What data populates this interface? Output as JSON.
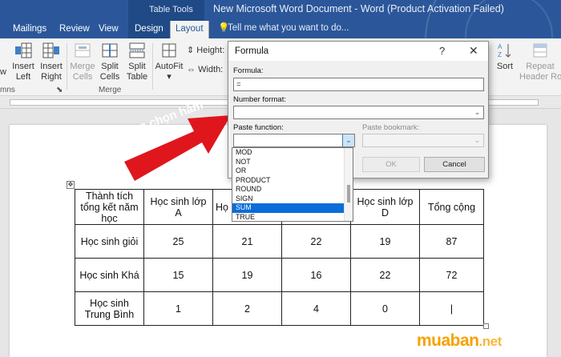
{
  "title_bar": {
    "context_label": "Table Tools",
    "document_title": "New Microsoft Word Document - Word (Product Activation Failed)",
    "tell_me": "Tell me what you want to do..."
  },
  "tabs": [
    "Mailings",
    "Review",
    "View",
    "Design",
    "Layout"
  ],
  "active_tab": "Layout",
  "ribbon": {
    "view_partial": "w",
    "insert_left": [
      "Insert",
      "Left"
    ],
    "insert_right": [
      "Insert",
      "Right"
    ],
    "merge_cells": [
      "Merge",
      "Cells"
    ],
    "split_cells": [
      "Split",
      "Cells"
    ],
    "split_table": [
      "Split",
      "Table"
    ],
    "autofit": "AutoFit",
    "height_label": "Height:",
    "width_label": "Width:",
    "sort": "Sort",
    "repeat_header": [
      "Repeat",
      "Header Row"
    ],
    "group_rows_partial": "mns",
    "group_merge": "Merge"
  },
  "dialog": {
    "title": "Formula",
    "help": "?",
    "close": "✕",
    "formula_label": "Formula:",
    "formula_value": "=",
    "number_format_label": "Number format:",
    "paste_function_label": "Paste function:",
    "paste_bookmark_label": "Paste bookmark:",
    "ok": "OK",
    "cancel": "Cancel",
    "functions": [
      "MOD",
      "NOT",
      "OR",
      "PRODUCT",
      "ROUND",
      "SIGN",
      "SUM",
      "TRUE"
    ],
    "selected_function": "SUM"
  },
  "annotation": "Lựa chọn hàm",
  "table": {
    "header": [
      "Thành tích tổng kết năm học",
      "Học sinh lớp A",
      "Họ",
      "",
      "Học sinh lớp D",
      "Tổng cộng"
    ],
    "rows": [
      [
        "Học sinh giỏi",
        "25",
        "21",
        "22",
        "19",
        "87"
      ],
      [
        "Học sinh Khá",
        "15",
        "19",
        "16",
        "22",
        "72"
      ],
      [
        "Học sinh Trung Bình",
        "1",
        "2",
        "4",
        "0",
        "|"
      ]
    ]
  },
  "watermark": {
    "main": "muaban",
    "suffix": ".net"
  },
  "colors": {
    "word_blue": "#2b579a",
    "selection": "#0a6dd9",
    "arrow_red": "#e0161d",
    "watermark": "#f5a200"
  }
}
